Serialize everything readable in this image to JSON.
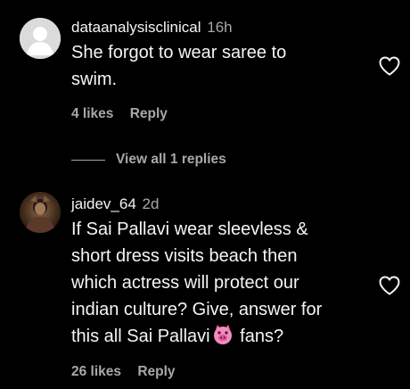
{
  "comments": [
    {
      "username": "dataanalysisclinical",
      "time": "16h",
      "text_lines": [
        "She forgot to wear saree to",
        "swim."
      ],
      "likes": "4 likes",
      "reply_label": "Reply"
    },
    {
      "username": "jaidev_64",
      "time": "2d",
      "text_lines": [
        "If Sai Pallavi wear sleevless &",
        "short dress visits beach then",
        "which actress will protect our",
        "indian culture? Give, answer for"
      ],
      "last_line_before_emoji": "this all Sai Pallavi",
      "last_line_after_emoji": " fans?",
      "emoji": "pig-face-emoji",
      "likes": "26 likes",
      "reply_label": "Reply"
    }
  ],
  "view_replies": "View all 1 replies",
  "icons": {
    "like": "heart-outline-icon",
    "default_avatar": "default-avatar-icon"
  },
  "colors": {
    "background": "#000000",
    "primary_text": "#f5f5f5",
    "secondary_text": "#a8a8a8"
  }
}
